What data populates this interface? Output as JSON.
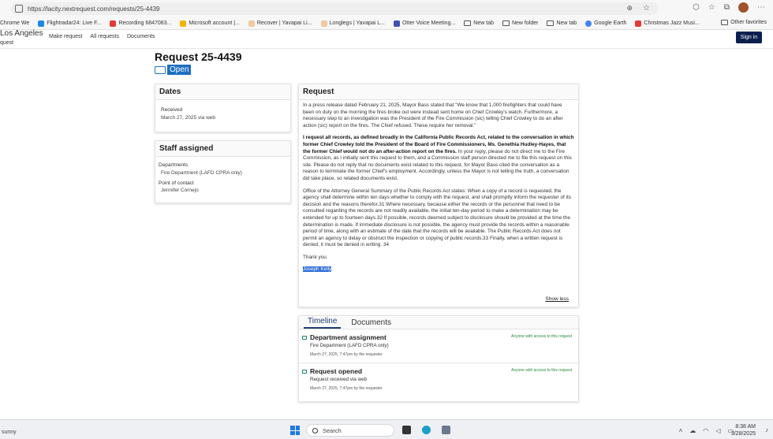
{
  "browser": {
    "url": "https://lacity.nextrequest.com/requests/25-4439",
    "bookmarks": [
      "Chrome We",
      "Flightradar24: Live F...",
      "Recording 6847083...",
      "Microsoft account |...",
      "Recover | Yavapai Li...",
      "Longlegs | Yavapai L...",
      "Otter Voice Meeting...",
      "New tab",
      "New folder",
      "New tab",
      "Google Earth",
      "Christmas Jazz Musi..."
    ],
    "other_favorites": "Other favorites"
  },
  "site": {
    "brand": "Los Angeles",
    "brand_sub": "quest",
    "nav": [
      "Make request",
      "All requests",
      "Documents"
    ],
    "signin": "Sign in"
  },
  "request": {
    "title": "Request 25-4439",
    "status": "Open",
    "dates": {
      "heading": "Dates",
      "received_label": "Received",
      "received_value": "March 27, 2025 via web"
    },
    "staff": {
      "heading": "Staff assigned",
      "departments_label": "Departments",
      "departments_value": "Fire Department (LAFD CPRA only)",
      "poc_label": "Point of contact",
      "poc_value": "Jennifer Cornejo"
    },
    "body": {
      "heading": "Request",
      "p1": "In a press release dated February 21, 2025, Mayor Bass stated that \"We know that 1,000 firefighters that could have been on duty on the morning the fires broke out were instead sent home on Chief Crowley's watch. Furthermore, a necessary step to an investigation was the President of the Fire Commission (sic) telling Chief Crowley to do an after action (sic) report on the fires. The Chief refused. These require her removal.\"",
      "p2_bold": "I request all records, as defined broadly in the California Public Records Act, related to the conversation in which former Chief Crowley told the President of the Board of Fire Commissioners, Ms. Genethia Hudley-Hayes, that the former Chief would not do an after-action report on the fires.",
      "p2_rest": " In your reply, please do not direct me to the Fire Commission, as I initially sent this request to them, and a Commission staff person directed me to file this request on this site. Please do not reply that no documents exist related to this request, for Mayor Bass cited the conversation as a reason to terminate the former Chief's employment. Accordingly, unless the Mayor is not telling the truth, a conversation did take place, so related documents exist.",
      "p3": "Office of the Attorney General Summary of the Public Records Act states: When a copy of a record is requested, the agency shall determine within ten days whether to comply with the request, and shall promptly inform the requester of its decision and the reasons therefor.31 Where necessary, because either the records or the personnel that need to be consulted regarding the records are not readily available, the initial ten-day period to make a determination may be extended for up to fourteen days.32 If possible, records deemed subject to disclosure should be provided at the time the determination is made. If immediate disclosure is not possible, the agency must provide the records within a reasonable period of time, along with an estimate of the date that the records will be available. The Public Records Act does not permit an agency to delay or obstruct the inspection or copying of public records.33 Finally, when a written request is denied, it must be denied in writing. 34",
      "thanks": "Thank you.",
      "signature": "Joseph Kelly",
      "show_less": "Show less"
    },
    "timeline": {
      "tabs": [
        "Timeline",
        "Documents"
      ],
      "events": [
        {
          "title": "Department assignment",
          "subtitle": "Fire Department (LAFD CPRA only)",
          "meta": "March 27, 2025, 7:47pm by the requester",
          "visibility": "Anyone with access to this request"
        },
        {
          "title": "Request opened",
          "subtitle": "Request received via web",
          "meta": "March 27, 2025, 7:47pm by the requester",
          "visibility": "Anyone with access to this request"
        }
      ]
    }
  },
  "taskbar": {
    "weather": "sunny",
    "search_placeholder": "Search",
    "time": "8:38 AM",
    "date": "3/28/2025"
  },
  "colors": {
    "accent": "#1f6fbf",
    "signin_bg": "#0b1f4f",
    "highlight": "#2f6fd6",
    "visibility_green": "#2a8a3a"
  }
}
